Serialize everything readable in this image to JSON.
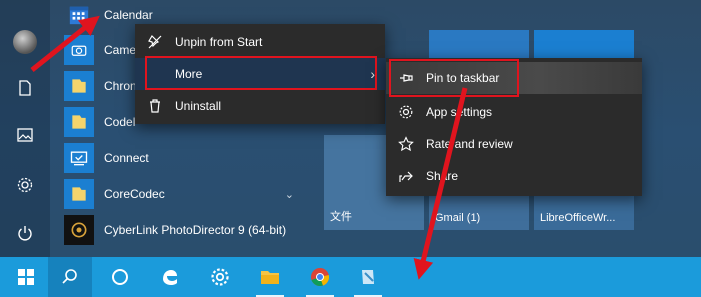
{
  "start_menu": {
    "rail": {
      "icons": [
        "user-avatar",
        "document-icon",
        "pictures-icon",
        "settings-icon",
        "power-icon"
      ]
    },
    "apps": [
      {
        "label": "Calendar",
        "icon": "calendar-icon"
      },
      {
        "label": "Came",
        "icon": "camera-icon"
      },
      {
        "label": "Chron",
        "icon": "folder-icon"
      },
      {
        "label": "Codel",
        "icon": "folder-icon"
      },
      {
        "label": "Connect",
        "icon": "connect-icon"
      },
      {
        "label": "CoreCodec",
        "icon": "folder-icon"
      },
      {
        "label": "CyberLink PhotoDirector 9 (64-bit)",
        "icon": "photodirector-icon"
      }
    ],
    "tiles": [
      {
        "label": "文件"
      },
      {
        "label": "Gmail (1)"
      },
      {
        "label": "LibreOfficeWr..."
      }
    ]
  },
  "context_menu": {
    "items": [
      {
        "label": "Unpin from Start",
        "icon": "unpin-icon"
      },
      {
        "label": "More",
        "icon": "",
        "arrow": "›"
      },
      {
        "label": "Uninstall",
        "icon": "trash-icon"
      }
    ]
  },
  "submenu": {
    "items": [
      {
        "label": "Pin to taskbar",
        "icon": "pin-icon"
      },
      {
        "label": "App settings",
        "icon": "gear-icon"
      },
      {
        "label": "Rate and review",
        "icon": "star-icon"
      },
      {
        "label": "Share",
        "icon": "share-icon"
      }
    ]
  },
  "taskbar": {
    "items": [
      "windows-start-icon",
      "search-icon",
      "cortana-icon",
      "edge-icon",
      "settings-icon",
      "file-explorer-icon",
      "chrome-icon",
      "notepad-icon"
    ]
  },
  "colors": {
    "accent": "#1b9bdb",
    "highlight": "#e0141e",
    "menu_bg": "#2b2b2b"
  }
}
